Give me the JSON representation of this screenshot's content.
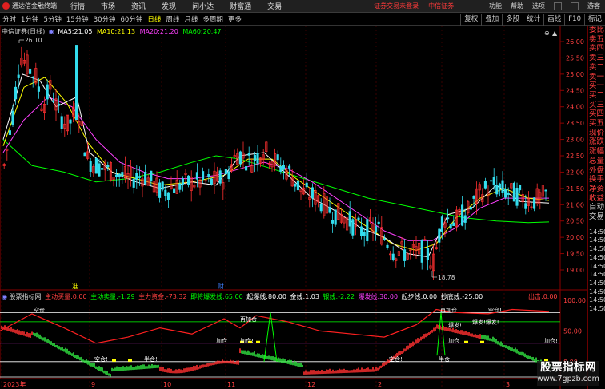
{
  "app": {
    "title": "通达信金融终端"
  },
  "menu": {
    "items": [
      "行情",
      "市场",
      "资讯",
      "发现",
      "问小达",
      "财富通",
      "交易"
    ],
    "login_notice": "证券交易未登录",
    "broker": "中信证券",
    "right": [
      "功能",
      "帮助",
      "选项"
    ],
    "guest": "游客"
  },
  "periods": {
    "items": [
      "分时",
      "1分钟",
      "5分钟",
      "15分钟",
      "30分钟",
      "60分钟",
      "日线",
      "周线",
      "月线",
      "多周期",
      "更多"
    ],
    "active_index": 6
  },
  "toolbar": [
    "复权",
    "叠加",
    "多股",
    "统计",
    "画线",
    "F10",
    "标记"
  ],
  "header": {
    "stock": "中信证券(日线)",
    "ma5_label": "MA5:",
    "ma5_value": "21.05",
    "ma10_label": "MA10:",
    "ma10_value": "21.13",
    "ma20_label": "MA20:",
    "ma20_value": "21.20",
    "ma60_label": "MA60:",
    "ma60_value": "20.47"
  },
  "price_axis": [
    "26.00",
    "25.50",
    "25.00",
    "24.50",
    "24.00",
    "23.50",
    "23.00",
    "22.50",
    "22.00",
    "21.50",
    "21.00",
    "20.50",
    "20.00",
    "19.50",
    "19.00"
  ],
  "price_marks": {
    "high": "26.10",
    "low": "18.78"
  },
  "indicator": {
    "name": "股票指标网",
    "buy_label": "主动买量:",
    "buy_value": "0.00",
    "sell_label": "主动卖量:",
    "sell_value": "-1.29",
    "main_label": "主力资金:",
    "main_value": "-73.32",
    "burst_label": "即将爆发线:",
    "burst_value": "65.00",
    "start_label": "起爆线:",
    "start_value": "80.00",
    "gold_label": "金线:",
    "gold_value": "1.03",
    "silver_label": "银线:",
    "silver_value": "-2.22",
    "bao_label": "爆发线:",
    "bao_value": "30.00",
    "qibu_label": "起步线:",
    "qibu_value": "0.00",
    "chaodi_label": "抄底线:",
    "chaodi_value": "-25.00",
    "exit_label": "出击:",
    "exit_value": "0.00",
    "axis": [
      "100.00",
      "50.00",
      "0.00"
    ],
    "markers": [
      "准",
      "财"
    ],
    "signals": [
      "空仓!",
      "再加仓",
      "加仓",
      "加仓!",
      "半仓!",
      "空仓!",
      "再加仓",
      "爆发!",
      "爆发!爆发!",
      "空仓!",
      "加仓!",
      "加仓",
      "半仓!",
      "空仓!"
    ]
  },
  "date_axis": [
    "2023年",
    "9",
    "10",
    "11",
    "12",
    "2",
    "3"
  ],
  "side_panel": {
    "items": [
      "委比",
      "卖五",
      "卖四",
      "卖三",
      "卖二",
      "卖一",
      "买一",
      "买二",
      "买三",
      "买四",
      "买五",
      "现价",
      "涨跌",
      "涨幅",
      "总量",
      "外盘",
      "换手",
      "净资",
      "收益",
      "自动",
      "交易"
    ],
    "times": [
      "14:50",
      "14:50",
      "14:50",
      "14:50",
      "14:50",
      "14:50",
      "14:50",
      "14:50",
      "14:50",
      "14:50"
    ]
  },
  "watermark": {
    "line1": "股票指标网",
    "line2": "www.7gpzb.com"
  },
  "colors": {
    "up": "#ff3030",
    "down": "#33ddee",
    "ma5": "#ffffff",
    "ma10": "#ffff00",
    "ma20": "#ff40ff",
    "ma60": "#00ff00",
    "accent": "#ff4040"
  }
}
